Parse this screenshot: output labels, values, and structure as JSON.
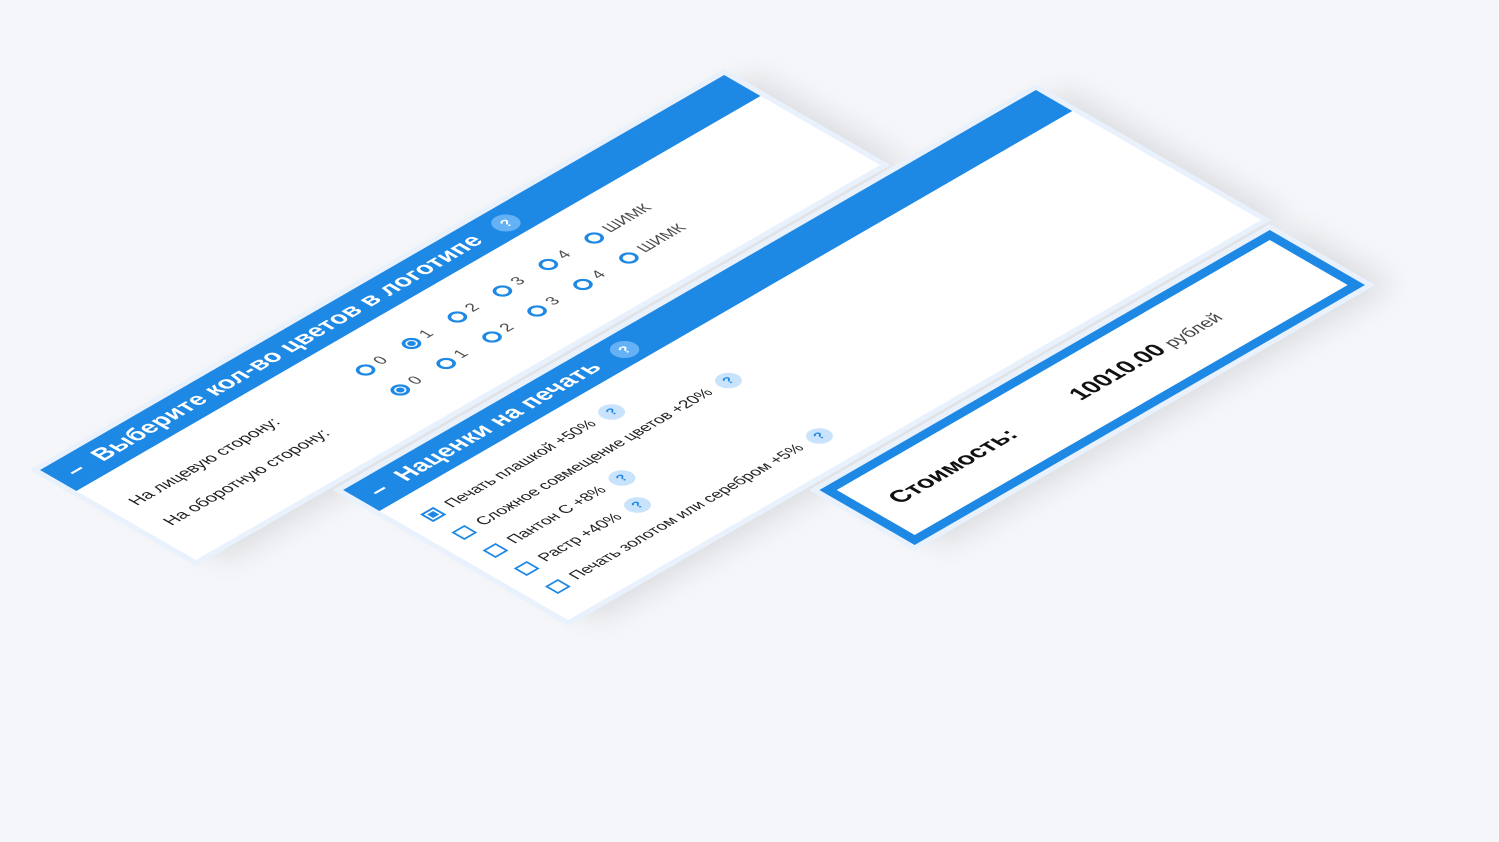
{
  "colors_section": {
    "title": "Выберите кол-во цветов в логотипе",
    "help": "?",
    "front_label": "На лицевую сторону:",
    "back_label": "На оборотную сторону:",
    "front_options": [
      "0",
      "1",
      "2",
      "3",
      "4",
      "ШИМК"
    ],
    "front_selected": "1",
    "back_options": [
      "0",
      "1",
      "2",
      "3",
      "4",
      "ШИМК"
    ],
    "back_selected": "0"
  },
  "markups_section": {
    "title": "Наценки на печать",
    "help": "?",
    "options": [
      {
        "label": "Печать плашкой +50%",
        "checked": true,
        "help": "?"
      },
      {
        "label": "Сложное совмещение цветов +20%",
        "checked": false,
        "help": "?"
      },
      {
        "label": "Пантон С +8%",
        "checked": false,
        "help": "?"
      },
      {
        "label": "Растр +40%",
        "checked": false,
        "help": "?"
      },
      {
        "label": "Печать золотом или серебром +5%",
        "checked": false,
        "help": "?"
      }
    ]
  },
  "cost": {
    "label": "Стоимость:",
    "value": "10010.00",
    "unit": "рублей"
  },
  "accent_color": "#1e88e5",
  "dash": "–"
}
